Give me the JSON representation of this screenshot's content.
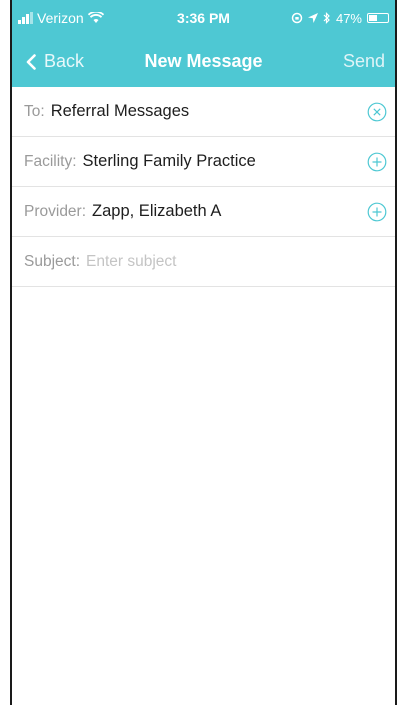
{
  "status_bar": {
    "carrier": "Verizon",
    "time": "3:36 PM",
    "battery": "47%",
    "battery_level": 0.47
  },
  "nav": {
    "back_label": "Back",
    "title": "New Message",
    "send_label": "Send"
  },
  "fields": {
    "to": {
      "label": "To:",
      "value": "Referral Messages",
      "action_icon": "clear-circle-icon"
    },
    "facility": {
      "label": "Facility:",
      "value": "Sterling Family Practice",
      "action_icon": "add-circle-icon"
    },
    "provider": {
      "label": "Provider:",
      "value": "Zapp, Elizabeth A",
      "action_icon": "add-circle-icon"
    },
    "subject": {
      "label": "Subject:",
      "placeholder": "Enter subject",
      "value": ""
    }
  },
  "colors": {
    "header_bg": "#4ec8d3",
    "accent": "#4ec8d3"
  }
}
